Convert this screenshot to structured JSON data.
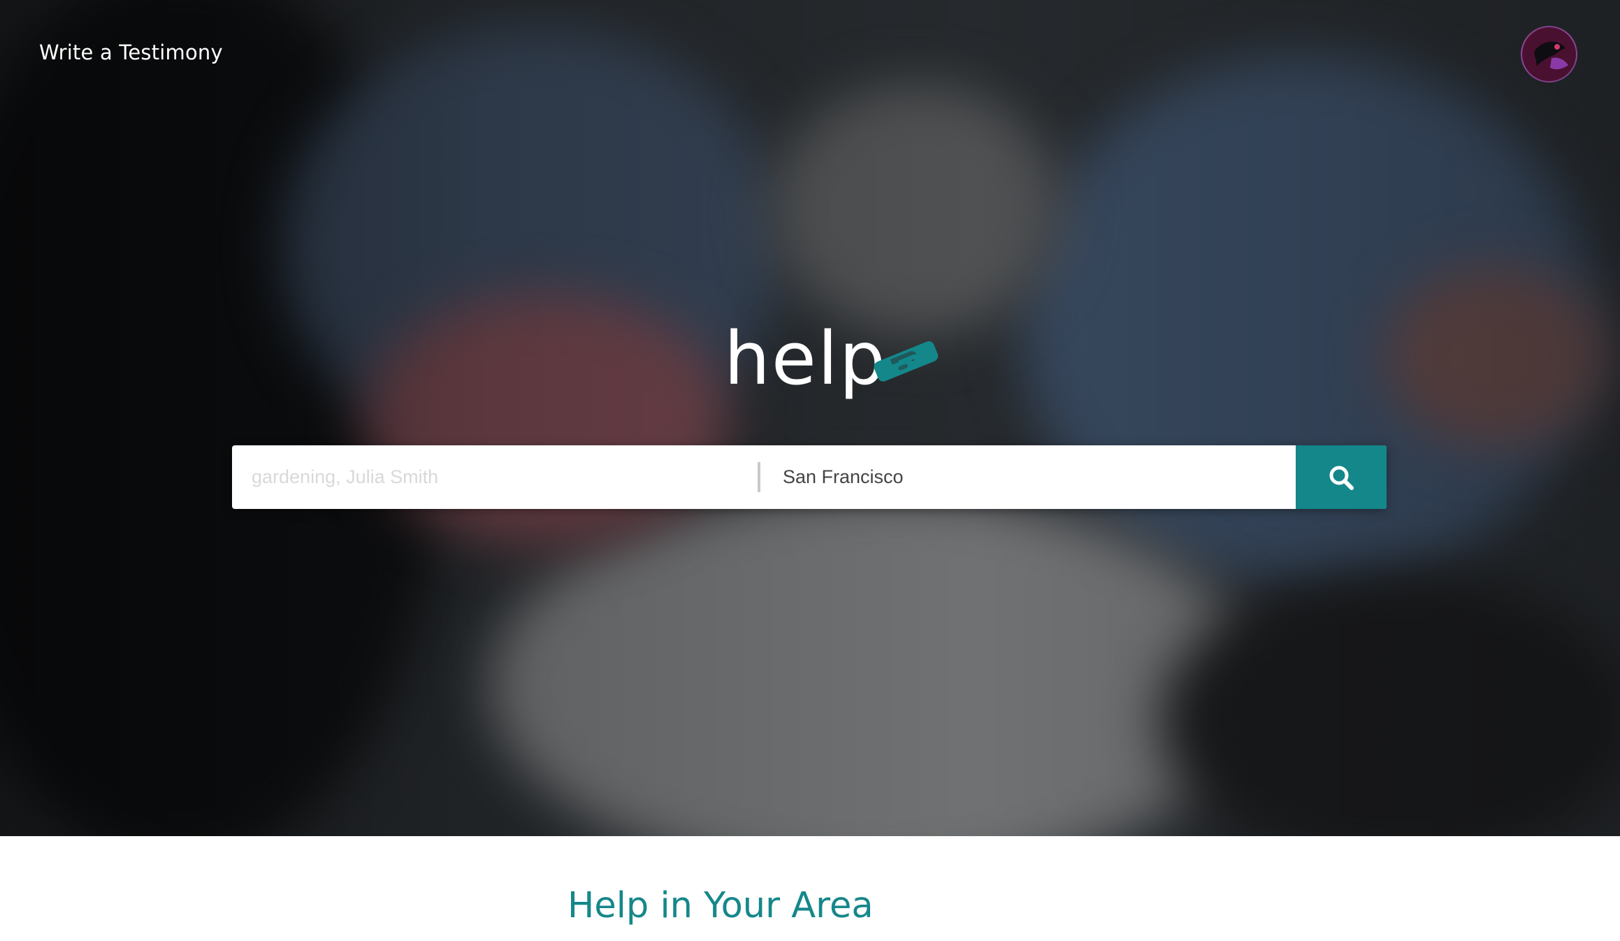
{
  "header": {
    "write_testimony_label": "Write a Testimony",
    "avatar_icon": "user-avatar"
  },
  "logo": {
    "text": "help",
    "icon": "handshake-icon"
  },
  "search": {
    "what_placeholder": "gardening, Julia Smith",
    "what_value": "",
    "where_value": "San Francisco",
    "button_icon": "search-icon"
  },
  "section": {
    "title": "Help in Your Area"
  },
  "colors": {
    "accent": "#13878a",
    "title_text": "#16878a",
    "hero_overlay": "#2b2f33",
    "white": "#ffffff"
  }
}
